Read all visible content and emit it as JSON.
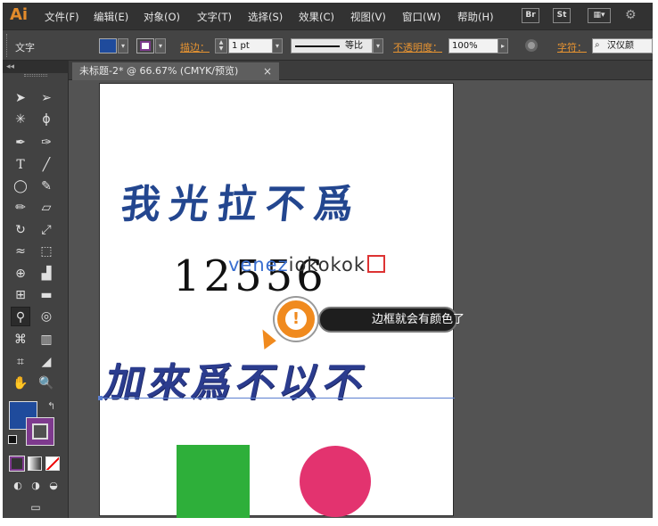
{
  "app": {
    "logo": "Ai"
  },
  "menu": [
    "文件(F)",
    "编辑(E)",
    "对象(O)",
    "文字(T)",
    "选择(S)",
    "效果(C)",
    "视图(V)",
    "窗口(W)",
    "帮助(H)"
  ],
  "menu_buttons": {
    "bridge": "Br",
    "stock": "St"
  },
  "control_bar": {
    "tool_label": "文字",
    "stroke_label": "描边：",
    "stroke_weight": "1 pt",
    "stroke_profile": "等比",
    "opacity_label": "不透明度：",
    "opacity_value": "100%",
    "char_label": "字符：",
    "font_value": "汉仪颜",
    "fill_color": "#1f4b9c",
    "stroke_color": "#7e3a8e"
  },
  "document": {
    "tab_title": "未标题-2* @ 66.67% (CMYK/预览)",
    "close": "×"
  },
  "artwork": {
    "heading": "我光拉不爲",
    "number": "12556",
    "watermark_a": "venez",
    "watermark_b": "iokokok",
    "line2": "加來爲不以不",
    "green": "#2eaf3a",
    "pink": "#e3336f"
  },
  "tooltip": {
    "text": "边框就会有颜色了",
    "icon": "!"
  },
  "tools_head": "◂◂"
}
